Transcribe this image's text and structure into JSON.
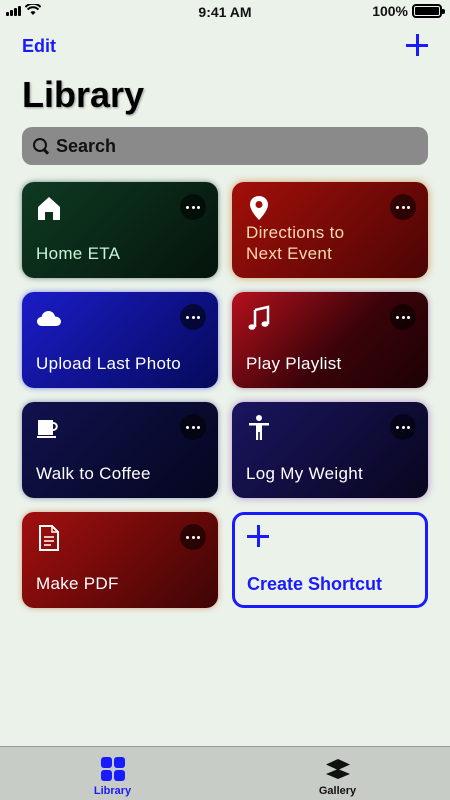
{
  "status_bar": {
    "time": "9:41 AM",
    "battery_text": "100%",
    "battery_level": 1.0
  },
  "nav": {
    "edit_label": "Edit",
    "add_icon": "plus-icon"
  },
  "page": {
    "title": "Library"
  },
  "search": {
    "placeholder": "Search",
    "icon": "search-icon"
  },
  "shortcuts": [
    {
      "label": "Home ETA",
      "icon": "house-icon",
      "color": "#0e3a22"
    },
    {
      "label": "Directions to Next Event",
      "icon": "location-pin-icon",
      "color": "#a30f0a"
    },
    {
      "label": "Upload Last Photo",
      "icon": "cloud-icon",
      "color": "#1a1cc7"
    },
    {
      "label": "Play Playlist",
      "icon": "music-note-icon",
      "color": "#b5101c"
    },
    {
      "label": "Walk to Coffee",
      "icon": "coffee-cup-icon",
      "color": "#11124e"
    },
    {
      "label": "Log My Weight",
      "icon": "person-icon",
      "color": "#1a1560"
    },
    {
      "label": "Make PDF",
      "icon": "document-icon",
      "color": "#a2100e"
    }
  ],
  "create_tile": {
    "label": "Create Shortcut",
    "icon": "plus-icon"
  },
  "tab_bar": {
    "tabs": [
      {
        "label": "Library",
        "icon": "grid-icon",
        "active": true
      },
      {
        "label": "Gallery",
        "icon": "layers-icon",
        "active": false
      }
    ]
  },
  "colors": {
    "accent": "#1a1aff",
    "background": "#eaf2ea"
  }
}
